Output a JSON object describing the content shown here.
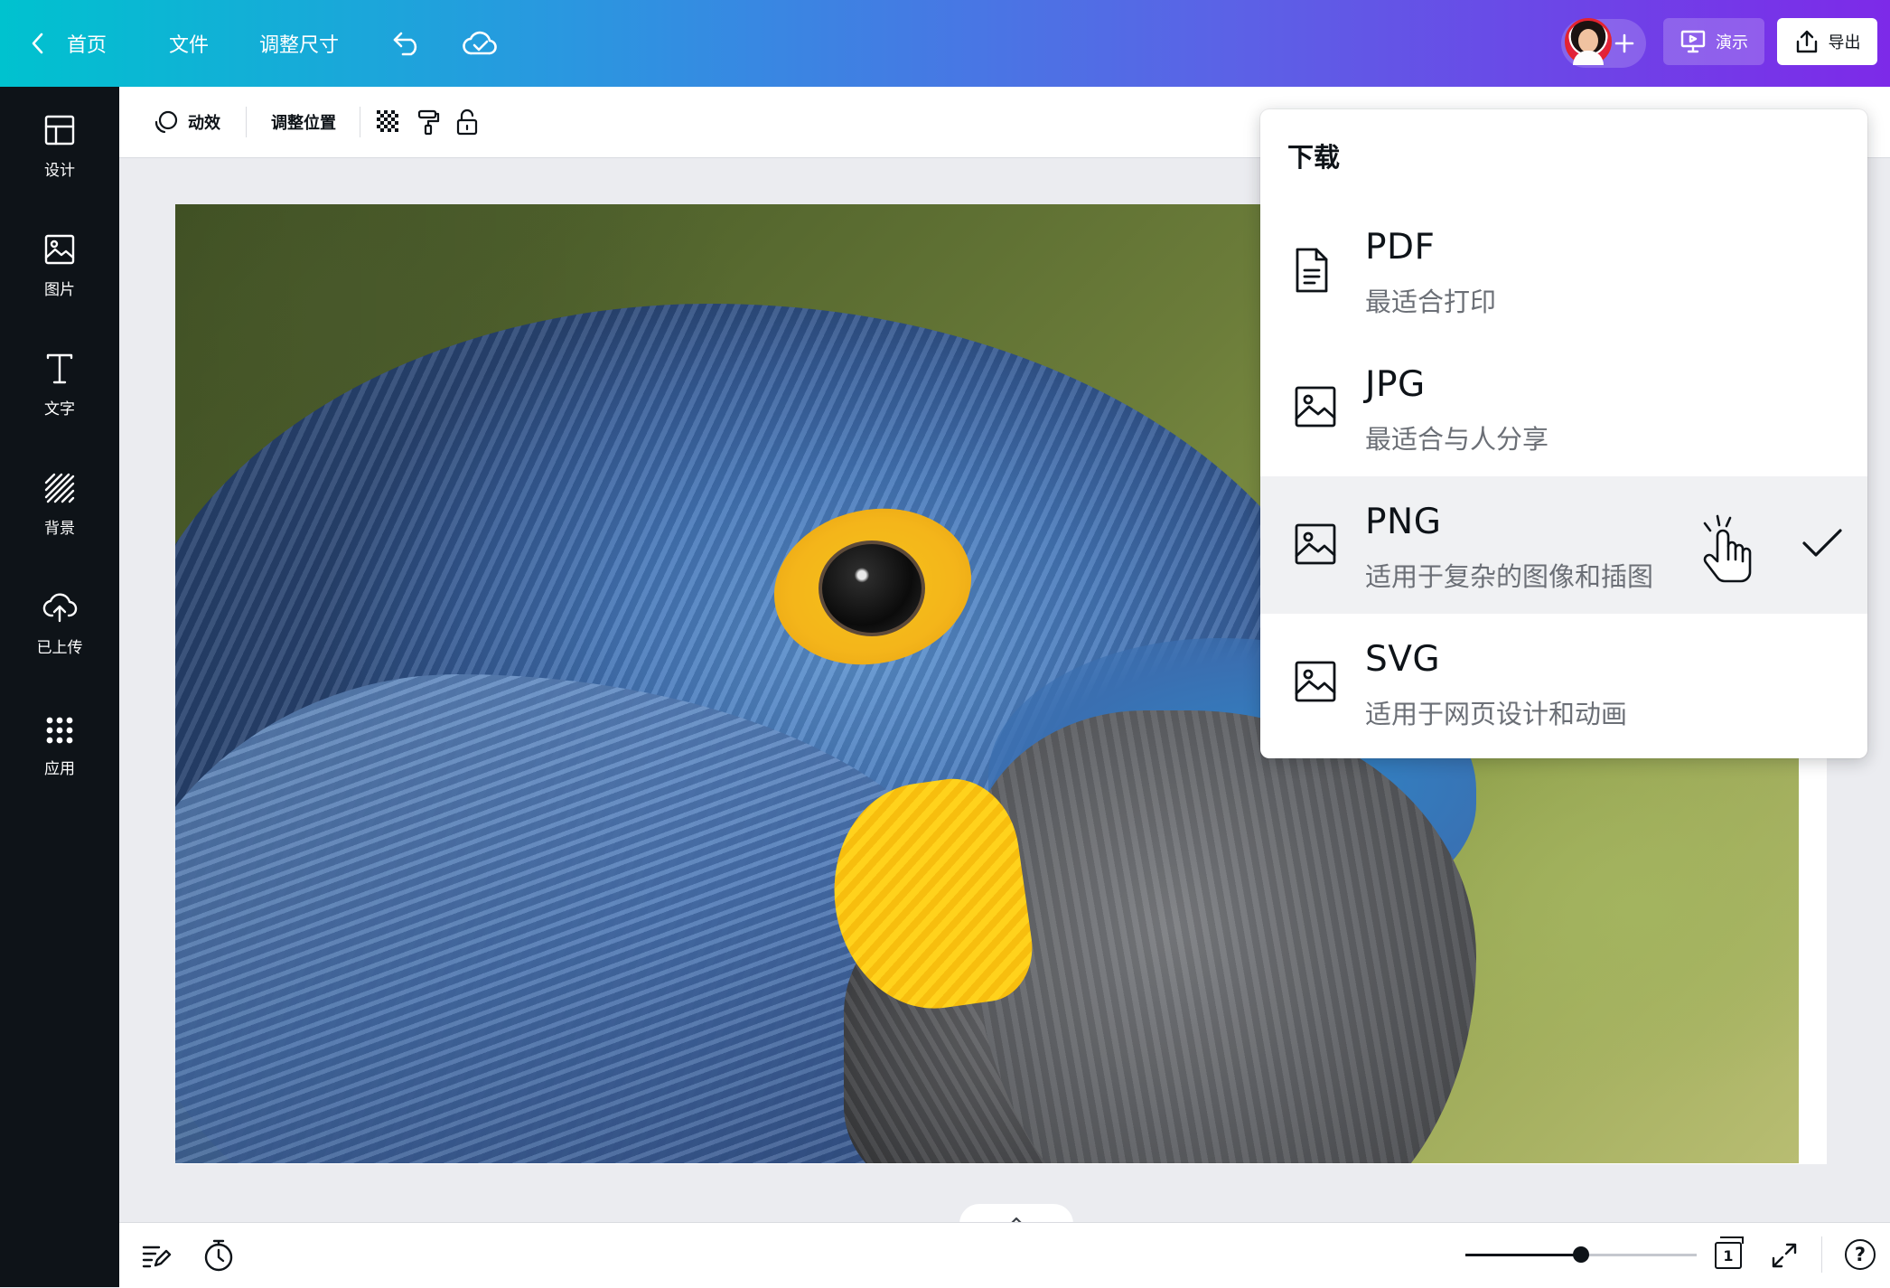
{
  "topbar": {
    "home_label": "首页",
    "file_label": "文件",
    "resize_label": "调整尺寸",
    "present_label": "演示",
    "export_label": "导出"
  },
  "sidebar": {
    "items": [
      {
        "label": "设计",
        "icon": "layout-icon"
      },
      {
        "label": "图片",
        "icon": "image-icon"
      },
      {
        "label": "文字",
        "icon": "text-icon"
      },
      {
        "label": "背景",
        "icon": "pattern-icon"
      },
      {
        "label": "已上传",
        "icon": "cloud-upload-icon"
      },
      {
        "label": "应用",
        "icon": "apps-grid-icon"
      }
    ]
  },
  "toolbar": {
    "animate_label": "动效",
    "position_label": "调整位置"
  },
  "dropdown": {
    "title": "下载",
    "items": [
      {
        "name": "PDF",
        "desc": "最适合打印",
        "icon": "document-icon"
      },
      {
        "name": "JPG",
        "desc": "最适合与人分享",
        "icon": "image-icon"
      },
      {
        "name": "PNG",
        "desc": "适用于复杂的图像和插图",
        "icon": "image-icon",
        "selected": true
      },
      {
        "name": "SVG",
        "desc": "适用于网页设计和动画",
        "icon": "image-icon"
      }
    ]
  },
  "bottombar": {
    "zoom_fraction": 0.5,
    "page_number": "1",
    "help_glyph": "?"
  }
}
